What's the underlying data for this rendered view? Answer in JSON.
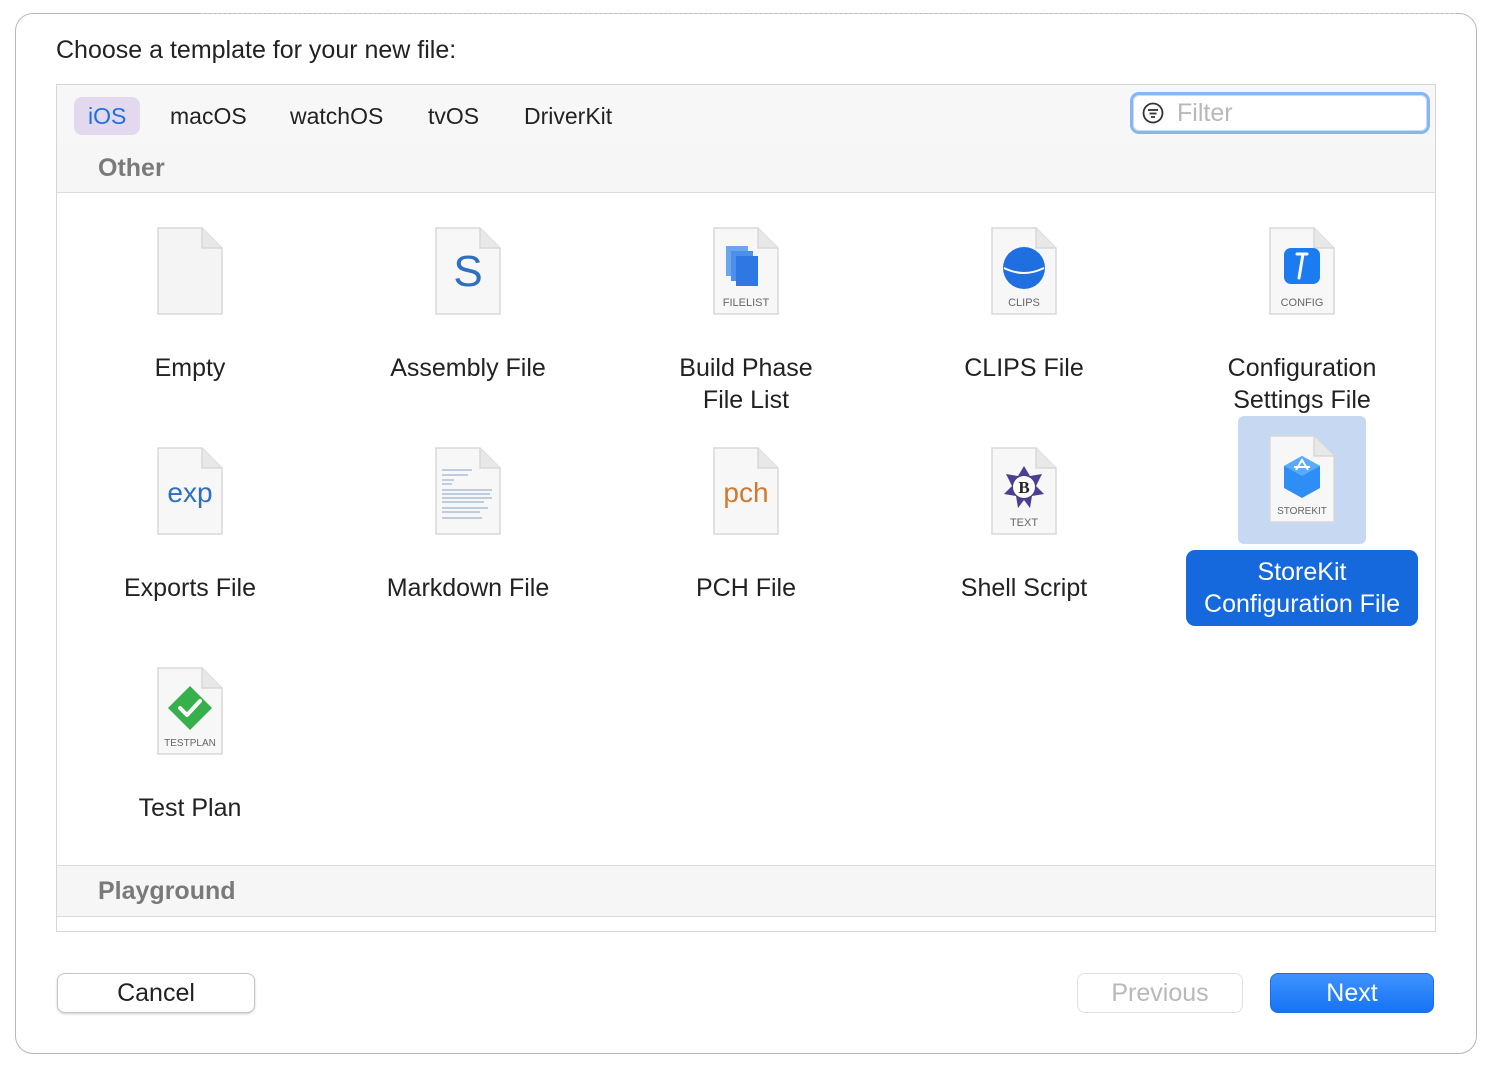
{
  "dialog": {
    "heading": "Choose a template for your new file:"
  },
  "platform_tabs": [
    {
      "label": "iOS",
      "selected": true
    },
    {
      "label": "macOS",
      "selected": false
    },
    {
      "label": "watchOS",
      "selected": false
    },
    {
      "label": "tvOS",
      "selected": false
    },
    {
      "label": "DriverKit",
      "selected": false
    }
  ],
  "filter": {
    "placeholder": "Filter",
    "icon": "filter-icon"
  },
  "sections": [
    {
      "title": "Other",
      "templates": [
        {
          "line1": "Empty",
          "line2": "",
          "icon": "empty-file-icon",
          "badge": ""
        },
        {
          "line1": "Assembly File",
          "line2": "",
          "icon": "assembly-file-icon",
          "badge": "S"
        },
        {
          "line1": "Build Phase",
          "line2": "File List",
          "icon": "filelist-icon",
          "badge": "FILELIST"
        },
        {
          "line1": "CLIPS File",
          "line2": "",
          "icon": "clips-icon",
          "badge": "CLIPS"
        },
        {
          "line1": "Configuration",
          "line2": "Settings File",
          "icon": "config-icon",
          "badge": "CONFIG"
        },
        {
          "line1": "Exports File",
          "line2": "",
          "icon": "exports-file-icon",
          "badge": "exp"
        },
        {
          "line1": "Markdown File",
          "line2": "",
          "icon": "markdown-file-icon",
          "badge": ""
        },
        {
          "line1": "PCH File",
          "line2": "",
          "icon": "pch-file-icon",
          "badge": "pch"
        },
        {
          "line1": "Shell Script",
          "line2": "",
          "icon": "shell-script-icon",
          "badge": "TEXT"
        },
        {
          "line1": "StoreKit",
          "line2": "Configuration File",
          "icon": "storekit-icon",
          "badge": "STOREKIT",
          "selected": true
        },
        {
          "line1": "Test Plan",
          "line2": "",
          "icon": "testplan-icon",
          "badge": "TESTPLAN"
        }
      ]
    },
    {
      "title": "Playground",
      "templates": []
    }
  ],
  "buttons": {
    "cancel": "Cancel",
    "previous": "Previous",
    "next": "Next"
  },
  "colors": {
    "accent": "#1668dd",
    "selected_tab_bg": "#e3d9ef",
    "selected_icon_bg": "#c7d8f3"
  }
}
